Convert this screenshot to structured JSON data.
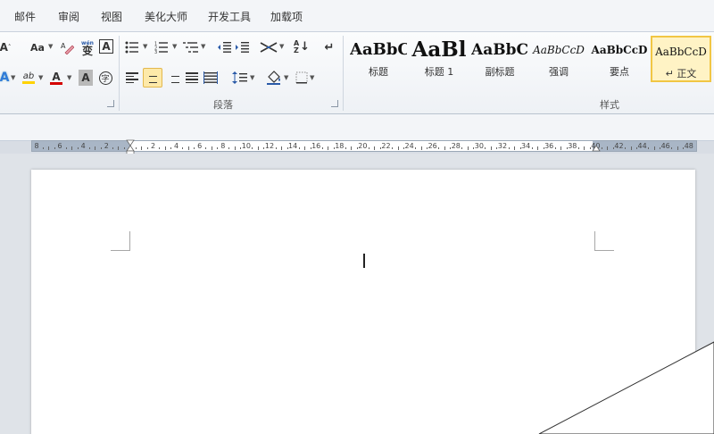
{
  "menu_tabs": [
    "邮件",
    "审阅",
    "视图",
    "美化大师",
    "开发工具",
    "加载项"
  ],
  "font_group": {
    "grow_font_label": "A",
    "change_case_label": "Aa",
    "char_border_label": "A",
    "font_color_label": "A",
    "char_shading_label": "A",
    "enclose_char_label": "字",
    "phonetic_icon_label": "wén 变",
    "highlight_icon_label": "ab"
  },
  "paragraph_group": {
    "label": "段落",
    "sort_label": "A↓Z",
    "active_alignment": "center"
  },
  "styles_group": {
    "label": "样式",
    "items": [
      {
        "preview": "AaBbC",
        "name": "标题"
      },
      {
        "preview": "AaBl",
        "name": "标题 1"
      },
      {
        "preview": "AaBbC",
        "name": "副标题"
      },
      {
        "preview": "AaBbCcD",
        "name": "强调"
      },
      {
        "preview": "AaBbCcD",
        "name": "要点"
      },
      {
        "preview": "AaBbCcD",
        "name": "↵ 正文",
        "selected": true
      }
    ]
  },
  "ruler": {
    "labels": [
      "8",
      "6",
      "4",
      "2",
      "",
      "2",
      "4",
      "6",
      "8",
      "10",
      "12",
      "14",
      "16",
      "18",
      "20",
      "22",
      "24",
      "26",
      "28",
      "30",
      "32",
      "34",
      "36",
      "38",
      "40",
      "42",
      "44",
      "46",
      "48"
    ]
  },
  "colors": {
    "selected_style_border": "#f1c644",
    "active_button_bg": "#fde9a9",
    "font_color_bar": "#d40000",
    "highlight_bar": "#ffd200"
  }
}
